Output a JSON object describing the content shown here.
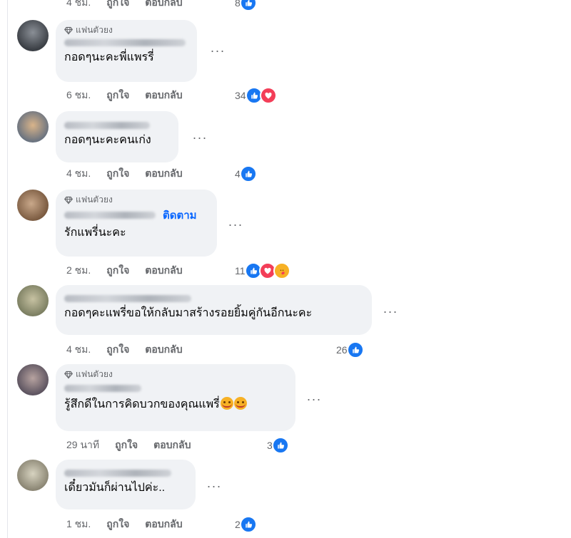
{
  "top_row": {
    "time": "4 ชม.",
    "like": "ถูกใจ",
    "reply": "ตอบกลับ",
    "count": "8"
  },
  "more_glyph": "···",
  "comments": [
    {
      "badge": "แฟนตัวยง",
      "text": "กอดๆนะคะพี่แพรรี่",
      "time": "6 ชม.",
      "like": "ถูกใจ",
      "reply": "ตอบกลับ",
      "count": "34",
      "reactions": [
        "like",
        "love"
      ]
    },
    {
      "text": "กอดๆนะคะคนเก่ง",
      "time": "4 ชม.",
      "like": "ถูกใจ",
      "reply": "ตอบกลับ",
      "count": "4",
      "reactions": [
        "like"
      ]
    },
    {
      "badge": "แฟนตัวยง",
      "follow": "ติดตาม",
      "text": "รักแพรี่นะคะ",
      "time": "2 ชม.",
      "like": "ถูกใจ",
      "reply": "ตอบกลับ",
      "count": "11",
      "reactions": [
        "like",
        "love",
        "care"
      ]
    },
    {
      "text": "กอดๆคะแพรี่ขอให้กลับมาสร้างรอยยิ้มคู่กันอีกนะคะ",
      "time": "4 ชม.",
      "like": "ถูกใจ",
      "reply": "ตอบกลับ",
      "count": "26",
      "reactions": [
        "like"
      ]
    },
    {
      "badge": "แฟนตัวยง",
      "text": "รู้สึกดีในการคิดบวกของคุณแพรี่",
      "emojis": [
        "smiling-face-with-hearts",
        "smiling-face-with-hearts"
      ],
      "time": "29 นาที",
      "like": "ถูกใจ",
      "reply": "ตอบกลับ",
      "count": "3",
      "reactions": [
        "like"
      ]
    },
    {
      "text": "เดี๋ยวมันก็ผ่านไปค่ะ..",
      "time": "1 ชม.",
      "like": "ถูกใจ",
      "reply": "ตอบกลับ",
      "count": "2",
      "reactions": [
        "like"
      ]
    }
  ],
  "colors": {
    "like": "#1877f2",
    "love": "#f33e58",
    "care": "#f7b125",
    "link": "#0866ff",
    "bubble": "#f0f2f5"
  }
}
